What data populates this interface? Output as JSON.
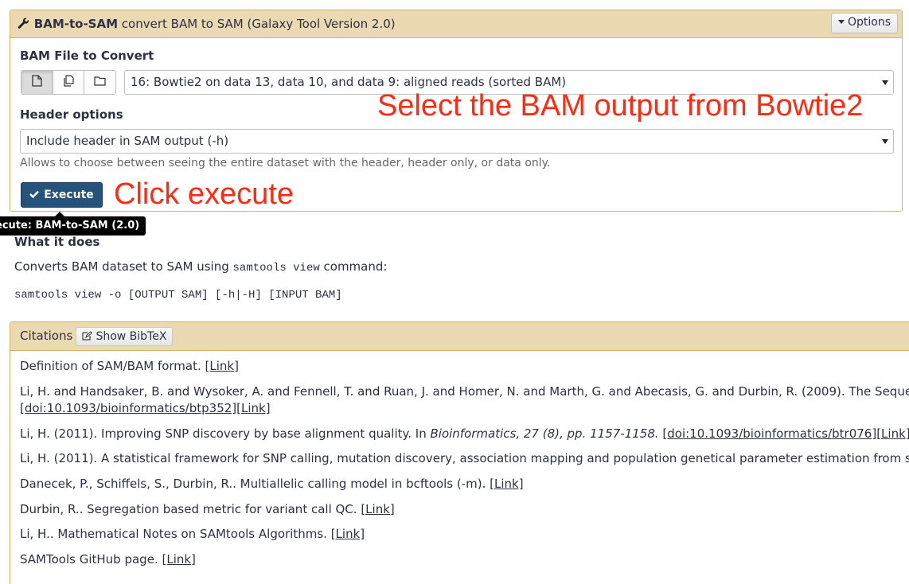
{
  "tool": {
    "name": "BAM-to-SAM",
    "description": "convert BAM to SAM (Galaxy Tool Version 2.0)",
    "options_label": "Options"
  },
  "form": {
    "bam_label": "BAM File to Convert",
    "bam_value": "16: Bowtie2 on data 13, data 10, and data 9: aligned reads (sorted BAM)",
    "header_label": "Header options",
    "header_value": "Include header in SAM output (-h)",
    "header_help": "Allows to choose between seeing the entire dataset with the header, header only, or data only.",
    "execute_label": "Execute"
  },
  "tooltip": "ecute: BAM-to-SAM (2.0)",
  "annotations": {
    "select_bam": "Select the BAM output from Bowtie2",
    "click_execute": "Click execute"
  },
  "help": {
    "title": "What it does",
    "desc_prefix": "Converts BAM dataset to SAM using ",
    "desc_code": "samtools view",
    "desc_suffix": " command:",
    "command": "samtools view -o [OUTPUT SAM] [-h|-H] [INPUT BAM]"
  },
  "citations": {
    "title": "Citations",
    "bibtex_label": "Show BibTeX",
    "items": [
      {
        "text": "Definition of SAM/BAM format. ",
        "link": "[Link]"
      },
      {
        "text": "Li, H. and Handsaker, B. and Wysoker, A. and Fennell, T. and Ruan, J. and Homer, N. and Marth, G. and Abecasis, G. and Durbin, R. (2009). The Sequence",
        "doi": "[doi:10.1093/bioinformatics/btp352]",
        "link": "[Link]"
      },
      {
        "text": "Li, H. (2011). Improving SNP discovery by base alignment quality. In ",
        "journal": "Bioinformatics, 27 (8), pp. 1157-1158.",
        "doi": "[doi:10.1093/bioinformatics/btr076]",
        "link": "[Link]"
      },
      {
        "text": "Li, H. (2011). A statistical framework for SNP calling, mutation discovery, association mapping and population genetical parameter estimation from seque"
      },
      {
        "text": "Danecek, P., Schiffels, S., Durbin, R.. Multiallelic calling model in bcftools (-m). ",
        "link": "[Link]"
      },
      {
        "text": "Durbin, R.. Segregation based metric for variant call QC. ",
        "link": "[Link]"
      },
      {
        "text": "Li, H.. Mathematical Notes on SAMtools Algorithms. ",
        "link": "[Link]"
      },
      {
        "text": "SAMTools GitHub page. ",
        "link": "[Link]"
      }
    ]
  },
  "icons": {
    "wrench": "wrench-icon",
    "upload_single": "file-icon",
    "upload_multiple": "files-icon",
    "upload_collection": "folder-icon",
    "check": "check-icon",
    "edit": "edit-icon"
  },
  "colors": {
    "panel_header": "#ebd9b2",
    "panel_border": "#d8b365",
    "execute_bg": "#25537b",
    "annotation": "#ff2a12"
  }
}
